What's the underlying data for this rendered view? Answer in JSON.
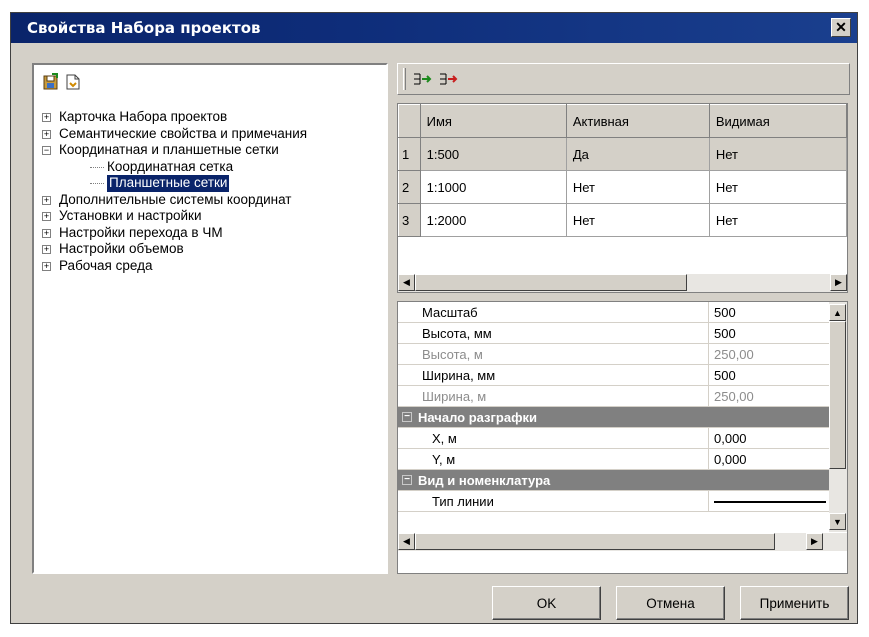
{
  "window": {
    "title": "Свойства Набора проектов"
  },
  "tree": {
    "items": [
      {
        "label": "Карточка Набора проектов",
        "expander": "+",
        "level": 0
      },
      {
        "label": "Семантические свойства и примечания",
        "expander": "+",
        "level": 0
      },
      {
        "label": "Координатная и планшетные сетки",
        "expander": "−",
        "level": 0
      },
      {
        "label": "Координатная сетка",
        "expander": "",
        "level": 1
      },
      {
        "label": "Планшетные сетки",
        "expander": "",
        "level": 1,
        "selected": true
      },
      {
        "label": "Дополнительные системы координат",
        "expander": "+",
        "level": 0
      },
      {
        "label": "Установки и настройки",
        "expander": "+",
        "level": 0
      },
      {
        "label": "Настройки перехода в ЧМ",
        "expander": "+",
        "level": 0
      },
      {
        "label": "Настройки объемов",
        "expander": "+",
        "level": 0
      },
      {
        "label": "Рабочая среда",
        "expander": "+",
        "level": 0
      }
    ]
  },
  "grid": {
    "columns": [
      "Имя",
      "Активная",
      "Видимая"
    ],
    "rows": [
      {
        "num": "1",
        "name": "1:500",
        "active": "Да",
        "visible": "Нет"
      },
      {
        "num": "2",
        "name": "1:1000",
        "active": "Нет",
        "visible": "Нет"
      },
      {
        "num": "3",
        "name": "1:2000",
        "active": "Нет",
        "visible": "Нет"
      }
    ]
  },
  "properties": {
    "scale_label": "Масштаб",
    "scale_value": "500",
    "height_mm_label": "Высота, мм",
    "height_mm_value": "500",
    "height_m_label": "Высота, м",
    "height_m_value": "250,00",
    "width_mm_label": "Ширина, мм",
    "width_mm_value": "500",
    "width_m_label": "Ширина, м",
    "width_m_value": "250,00",
    "cat1": "Начало разграфки",
    "x_label": "X, м",
    "x_value": "0,000",
    "y_label": "Y, м",
    "y_value": "0,000",
    "cat2": "Вид и номенклатура",
    "linetype_label": "Тип линии"
  },
  "buttons": {
    "ok": "OK",
    "cancel": "Отмена",
    "apply": "Применить"
  },
  "icons": {
    "close": "close-icon",
    "save": "save-icon",
    "load": "load-icon",
    "add": "add-row-icon",
    "remove": "remove-row-icon"
  }
}
